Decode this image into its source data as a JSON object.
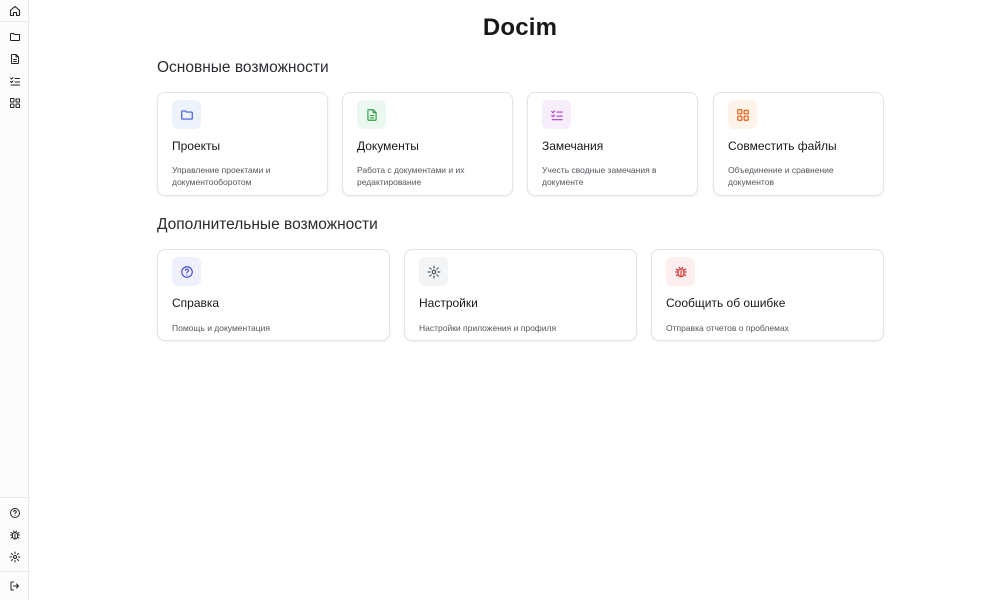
{
  "app": {
    "title": "Docim"
  },
  "sidebar": {
    "top": [
      {
        "id": "home",
        "icon": "home-icon"
      },
      {
        "id": "projects",
        "icon": "folder-icon"
      },
      {
        "id": "documents",
        "icon": "file-text-icon"
      },
      {
        "id": "remarks",
        "icon": "list-checks-icon"
      },
      {
        "id": "compare",
        "icon": "compare-files-icon"
      }
    ],
    "bottom": [
      {
        "id": "help",
        "icon": "help-circle-icon"
      },
      {
        "id": "bug",
        "icon": "bug-icon"
      },
      {
        "id": "settings",
        "icon": "gear-icon"
      },
      {
        "id": "logout",
        "icon": "logout-icon"
      }
    ]
  },
  "sections": {
    "main": {
      "title": "Основные возможности",
      "cards": [
        {
          "title": "Проекты",
          "desc": "Управление проектами и документооборотом",
          "icon": "folder-icon",
          "color": "#3b5bdb"
        },
        {
          "title": "Документы",
          "desc": "Работа с документами и их редактирование",
          "icon": "file-text-icon",
          "color": "#2f9e44"
        },
        {
          "title": "Замечания",
          "desc": "Учесть сводные замечания в документе",
          "icon": "list-checks-icon",
          "color": "#ae3ec9"
        },
        {
          "title": "Совместить файлы",
          "desc": "Объединение и сравнение документов",
          "icon": "compare-files-icon",
          "color": "#e8590c"
        }
      ]
    },
    "extra": {
      "title": "Дополнительные возможности",
      "cards": [
        {
          "title": "Справка",
          "desc": "Помощь и документация",
          "icon": "help-circle-icon",
          "color": "#4c4fcf"
        },
        {
          "title": "Настройки",
          "desc": "Настройки приложения и профиля",
          "icon": "gear-icon",
          "color": "#495057"
        },
        {
          "title": "Сообщить об ошибке",
          "desc": "Отправка отчетов о проблемах",
          "icon": "bug-icon",
          "color": "#e03131"
        }
      ]
    }
  }
}
